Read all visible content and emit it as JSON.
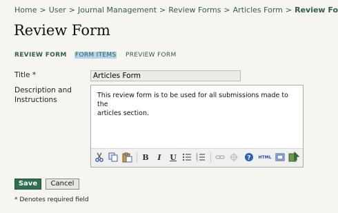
{
  "breadcrumb": {
    "items": [
      "Home",
      "User",
      "Journal Management",
      "Review Forms",
      "Articles Form"
    ],
    "current": "Review Form",
    "separator": ">"
  },
  "page": {
    "title": "Review Form"
  },
  "tabs": [
    {
      "label": "REVIEW FORM",
      "active": true
    },
    {
      "label": "FORM ITEMS",
      "active": false,
      "highlighted": true
    },
    {
      "label": "PREVIEW FORM",
      "active": false
    }
  ],
  "form": {
    "title_label": "Title *",
    "title_value": "Articles Form",
    "description_label_line1": "Description and",
    "description_label_line2": "Instructions",
    "description_line1": "This review form is to be used for all submissions made to the",
    "description_line2": "articles section."
  },
  "toolbar": {
    "icons": [
      "cut-icon",
      "copy-icon",
      "paste-icon",
      "bold-icon",
      "italic-icon",
      "underline-icon",
      "bullet-list-icon",
      "numbered-list-icon",
      "link-icon",
      "unlink-icon",
      "help-icon",
      "html-icon",
      "fullscreen-icon",
      "image-icon"
    ],
    "bold_glyph": "B",
    "italic_glyph": "I",
    "underline_glyph": "U",
    "html_glyph": "HTML"
  },
  "buttons": {
    "save": "Save",
    "cancel": "Cancel"
  },
  "note": "* Denotes required field",
  "colors": {
    "accent": "#2f6f4e",
    "background": "#f7f5ef",
    "link": "#2e5f4a"
  }
}
